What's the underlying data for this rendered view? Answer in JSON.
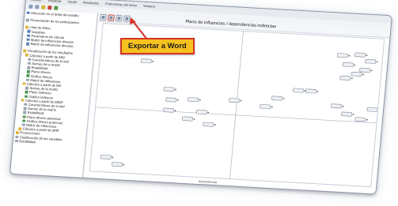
{
  "window": {
    "menu": [
      "Archivo",
      "Visualizar",
      "Ayuda",
      "Resultados",
      "Preferencias del motor",
      "Ventana"
    ]
  },
  "sidebar": {
    "items": [
      {
        "label": "Ubicación en el árbol del estudio",
        "level": 0,
        "icon": "blue"
      },
      {
        "label": "Presentación de los participantes",
        "level": 0,
        "icon": "gray",
        "gap": true
      },
      {
        "label": "Lista de datos",
        "level": 0,
        "icon": "yellow",
        "gap": true
      },
      {
        "label": "Variables",
        "level": 1,
        "icon": "blue"
      },
      {
        "label": "Parámetros de cálculo",
        "level": 1,
        "icon": "blue"
      },
      {
        "label": "Matriz de influencias directas",
        "level": 1,
        "icon": "blue"
      },
      {
        "label": "Matriz de influencias directas",
        "level": 1,
        "icon": "blue"
      },
      {
        "label": "Visualización de los resultados",
        "level": 0,
        "icon": "yellow",
        "gap": true
      },
      {
        "label": "Cálculos a partir de MID",
        "level": 1,
        "icon": "yellow"
      },
      {
        "label": "Características de la mid",
        "level": 2,
        "icon": "gray"
      },
      {
        "label": "Sumas de la matriz",
        "level": 2,
        "icon": "gray"
      },
      {
        "label": "Estabilidad",
        "level": 2,
        "icon": "gray"
      },
      {
        "label": "Plano directo",
        "level": 2,
        "icon": "green"
      },
      {
        "label": "Gráfico directo",
        "level": 2,
        "icon": "green"
      },
      {
        "label": "Matriz de influencias",
        "level": 2,
        "icon": "gray"
      },
      {
        "label": "Cálculos a partir de MII",
        "level": 1,
        "icon": "yellow"
      },
      {
        "label": "Sumas de la matriz",
        "level": 2,
        "icon": "gray"
      },
      {
        "label": "Plano indirecto",
        "level": 2,
        "icon": "green"
      },
      {
        "label": "Gráfico indirecto",
        "level": 2,
        "icon": "green"
      },
      {
        "label": "Cálculos a partir de MIDP",
        "level": 1,
        "icon": "yellow"
      },
      {
        "label": "Características de la mid",
        "level": 2,
        "icon": "gray"
      },
      {
        "label": "Sumas de la matriz",
        "level": 2,
        "icon": "gray"
      },
      {
        "label": "Estabilidad",
        "level": 2,
        "icon": "gray"
      },
      {
        "label": "Plano directo potencial",
        "level": 2,
        "icon": "green"
      },
      {
        "label": "Gráfico directo potencial",
        "level": 2,
        "icon": "green"
      },
      {
        "label": "Matriz de influencias",
        "level": 2,
        "icon": "gray"
      },
      {
        "label": "Cálculos a partir de MIIP",
        "level": 1,
        "icon": "yellow"
      },
      {
        "label": "Proyecciones",
        "level": 0,
        "icon": "yellow"
      },
      {
        "label": "Clasificación de las variables",
        "level": 0,
        "icon": "gray"
      },
      {
        "label": "Estabilidad",
        "level": 0,
        "icon": "gray"
      }
    ]
  },
  "main": {
    "title": "Plano de influencias / dependencias indirectas",
    "x_axis_label": "dependencia"
  },
  "callout": {
    "text": "Exportar a Word"
  },
  "colors": {
    "callout_fill": "#f7c21f",
    "callout_border": "#d4332a",
    "arrow": "#d4332a"
  }
}
